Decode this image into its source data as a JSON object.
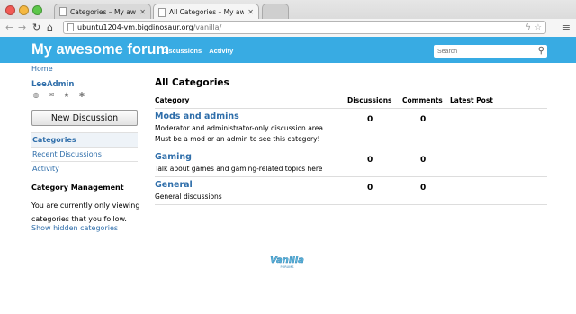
{
  "browser": {
    "tabs": [
      {
        "title": "Categories – My awesome fo",
        "active": false
      },
      {
        "title": "All Categories – My awesom",
        "active": true
      }
    ],
    "url_host": "ubuntu1204-vm.bigdinosaur.org",
    "url_path": "/vanilla/"
  },
  "site": {
    "title": "My awesome forum",
    "nav": [
      "Discussions",
      "Activity"
    ],
    "search_placeholder": "Search"
  },
  "breadcrumb": "Home",
  "user": {
    "name": "LeeAdmin",
    "icons": [
      "globe-icon",
      "mail-icon",
      "star-icon",
      "gear-icon"
    ]
  },
  "sidebar": {
    "new_discussion_label": "New Discussion",
    "items": [
      {
        "label": "Categories",
        "active": true
      },
      {
        "label": "Recent Discussions",
        "active": false
      },
      {
        "label": "Activity",
        "active": false
      }
    ],
    "management_title": "Category Management",
    "management_text": "You are currently only viewing categories that you follow.",
    "show_hidden_label": "Show hidden categories"
  },
  "main": {
    "title": "All Categories",
    "columns": [
      "Category",
      "Discussions",
      "Comments",
      "Latest Post"
    ],
    "categories": [
      {
        "name": "Mods and admins",
        "description": "Moderator and administrator-only discussion area. Must be a mod or an admin to see this category!",
        "discussions": "0",
        "comments": "0"
      },
      {
        "name": "Gaming",
        "description": "Talk about games and gaming-related topics here",
        "discussions": "0",
        "comments": "0"
      },
      {
        "name": "General",
        "description": "General discussions",
        "discussions": "0",
        "comments": "0"
      }
    ]
  },
  "footer": {
    "logo_text": "Vanilla",
    "logo_subtext": "FORUMS"
  },
  "colors": {
    "header": "#38abe3",
    "link": "#2f6eaa"
  }
}
